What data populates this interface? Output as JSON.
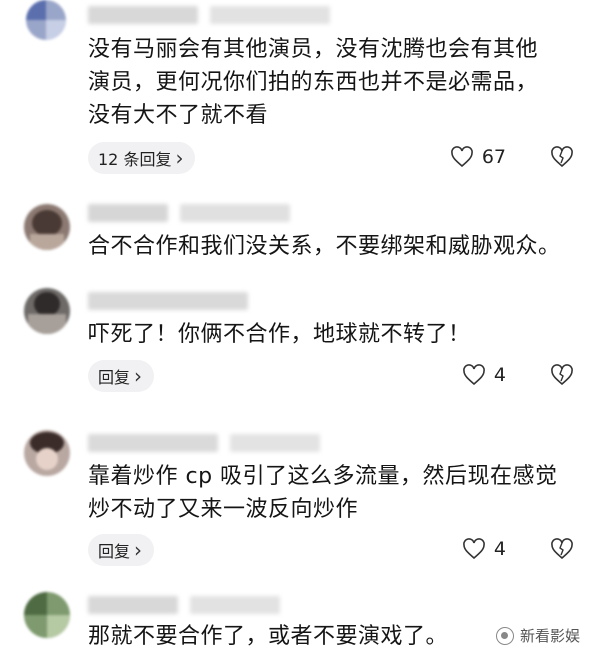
{
  "comments": [
    {
      "lines": [
        "没有马丽会有其他演员，没有沈腾也会有其他",
        "演员，更何况你们拍的东西也并不是必需品，",
        "没有大不了就不看"
      ],
      "reply_label": "12 条回复",
      "likes": "67"
    },
    {
      "lines": [
        "合不合作和我们没关系，不要绑架和威胁观众。"
      ]
    },
    {
      "lines": [
        "吓死了！你俩不合作，地球就不转了！"
      ],
      "reply_label": "回复",
      "likes": "4"
    },
    {
      "lines": [
        "靠着炒作 cp 吸引了这么多流量，然后现在感觉",
        "炒不动了又来一波反向炒作"
      ],
      "reply_label": "回复",
      "likes": "4"
    },
    {
      "lines": [
        "那就不要合作了，或者不要演戏了。"
      ]
    }
  ],
  "watermark": "新看影娱",
  "icons": {
    "chevron": "chevron-right-icon",
    "like": "heart-outline-icon",
    "dislike": "broken-heart-icon"
  },
  "colors": {
    "pill_bg": "#f1f1f3",
    "text": "#151515"
  }
}
